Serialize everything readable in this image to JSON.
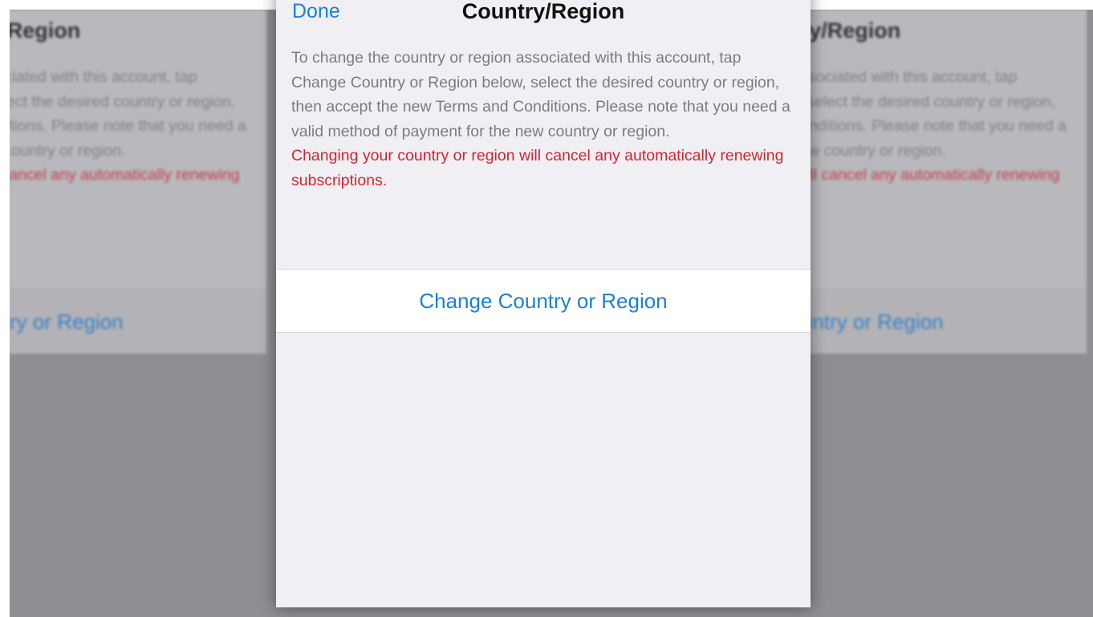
{
  "nav": {
    "done_label": "Done",
    "title": "Country/Region"
  },
  "info": {
    "description": "To change the country or region associated with this account, tap Change Country or Region below, select the desired country or region, then accept the new Terms and Conditions. Please note that you need a valid method of payment for the new country or region.",
    "warning": "Changing your country or region will cancel any automatically renewing subscriptions."
  },
  "actions": {
    "change_country_label": "Change Country or Region"
  },
  "colors": {
    "accent": "#1a7fdc",
    "warning": "#d9232d",
    "background": "#efeff4",
    "overlay": "#8e8e93"
  }
}
